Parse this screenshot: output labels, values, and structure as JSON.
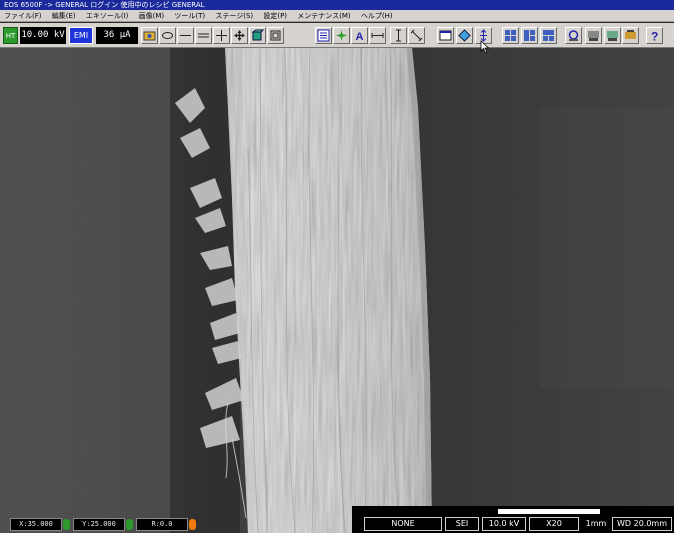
{
  "window": {
    "title": "EOS 6500F -> GENERAL ログイン 使用中のレシピ GENERAL"
  },
  "menu": [
    "ファイル(F)",
    "編集(E)",
    "エキソール(I)",
    "画像(M)",
    "ツール(T)",
    "ステージ(S)",
    "設定(P)",
    "メンテナンス(M)",
    "ヘルプ(H)"
  ],
  "toolbar": {
    "ht_label": "HT",
    "voltage": "10.00 kV",
    "emi_label": "EMI",
    "current": "36  μA",
    "icons": {
      "t1": "image-capture-icon",
      "t2": "ellipse-icon",
      "t3": "horizontal-line-icon",
      "t4": "vertical-line-icon",
      "t5": "crosshair-icon",
      "t6": "move-icon",
      "t7": "box-3d-icon",
      "t8": "frame-icon",
      "t9": "scan-icon",
      "t10": "starburst-icon",
      "t11": "text-icon",
      "t12": "width-measure-icon",
      "t13": "height-measure-icon",
      "t14": "diagonal-measure-icon",
      "t15": "window-icon",
      "t16": "diamond-icon",
      "t17": "vertical-arrows-icon",
      "t18": "grid-a-icon",
      "t19": "grid-b-icon",
      "t20": "grid-c-icon",
      "t21": "image-a-icon",
      "t22": "image-b-icon",
      "t23": "image-c-icon",
      "t24": "image-d-icon",
      "t25": "help-icon"
    }
  },
  "status": {
    "x": "X:35.000",
    "y": "Y:25.000",
    "r": "R:0.0",
    "colors": {
      "x_led": "#2c9a2c",
      "y_led": "#2c9a2c",
      "r_led": "#f07a10"
    }
  },
  "info": {
    "mode": "NONE",
    "detector": "SEI",
    "voltage": "10.0 kV",
    "magnification": "X20",
    "scale": "1mm",
    "wd": "WD 20.0mm"
  }
}
